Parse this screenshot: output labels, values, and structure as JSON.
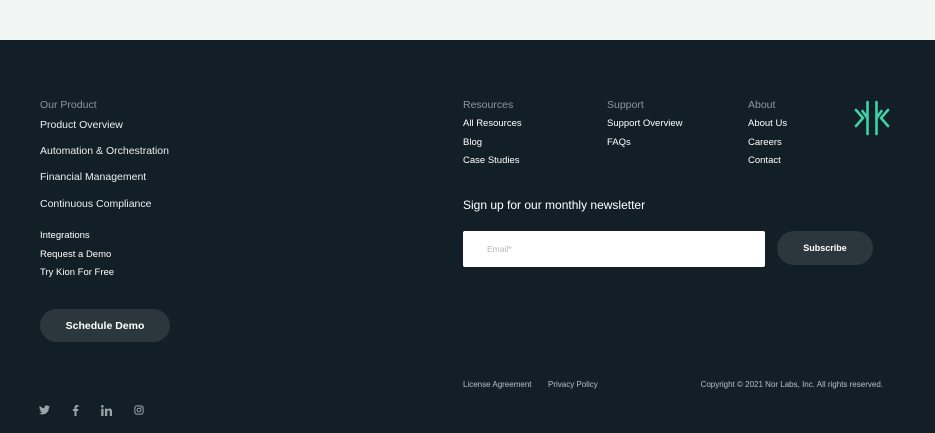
{
  "product": {
    "heading": "Our Product",
    "links": [
      "Product Overview",
      "Automation & Orchestration",
      "Financial Management",
      "Continuous Compliance"
    ],
    "secondary_links": [
      "Integrations",
      "Request a Demo",
      "Try Kion For Free"
    ],
    "schedule_label": "Schedule Demo"
  },
  "resources": {
    "heading": "Resources",
    "links": [
      "All Resources",
      "Blog",
      "Case Studies"
    ]
  },
  "support": {
    "heading": "Support",
    "links": [
      "Support Overview",
      "FAQs"
    ]
  },
  "about": {
    "heading": "About",
    "links": [
      "About Us",
      "Careers",
      "Contact"
    ]
  },
  "newsletter": {
    "title": "Sign up for our monthly newsletter",
    "email_placeholder": "Email*",
    "email_value": "",
    "subscribe_label": "Subscribe"
  },
  "legal": {
    "license": "License Agreement",
    "privacy": "Privacy Policy",
    "copyright": "Copyright © 2021 Nor Labs, Inc. All rights reserved."
  },
  "social_icons": [
    "twitter-icon",
    "facebook-icon",
    "linkedin-icon",
    "instagram-icon"
  ],
  "colors": {
    "footer_bg": "#131f26",
    "top_bg": "#f1f5f3",
    "button_bg": "#2b373d",
    "logo_green": "#3fd3a7",
    "muted_text": "#8c979c"
  }
}
